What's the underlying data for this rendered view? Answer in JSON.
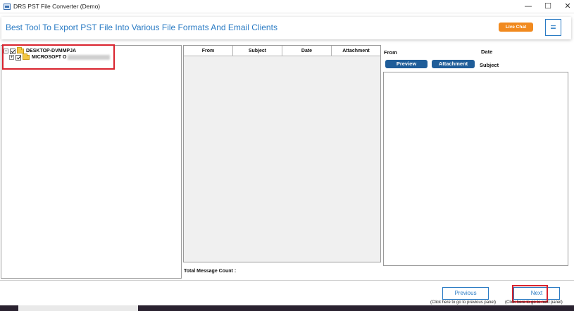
{
  "window": {
    "title": "DRS PST File Converter (Demo)",
    "minimize": "—",
    "maximize": "☐",
    "close": "✕"
  },
  "header": {
    "headline": "Best Tool To Export PST File Into Various File Formats And Email Clients",
    "live_chat": "Live Chat",
    "menu": "≡"
  },
  "tree": {
    "root_expander": "−",
    "root_label": "DESKTOP-DVMMPJA",
    "child_expander": "+",
    "child_label": "MICROSOFT O"
  },
  "message_list": {
    "columns": [
      "From",
      "Subject",
      "Date",
      "Attachment"
    ],
    "count_label": "Total Message Count :"
  },
  "preview": {
    "from_label": "From",
    "date_label": "Date",
    "subject_label": "Subject",
    "preview_button": "Preview",
    "attachment_button": "Attachment"
  },
  "footer": {
    "previous_button": "Previous",
    "previous_hint": "(Click here to go to previous panel)",
    "next_button": "Next",
    "next_hint": "(Click here to go to next panel)"
  },
  "colors": {
    "accent": "#2a7bc4",
    "pill": "#1f5d99",
    "live_chat": "#f18a1f",
    "highlight": "#d9232e"
  }
}
